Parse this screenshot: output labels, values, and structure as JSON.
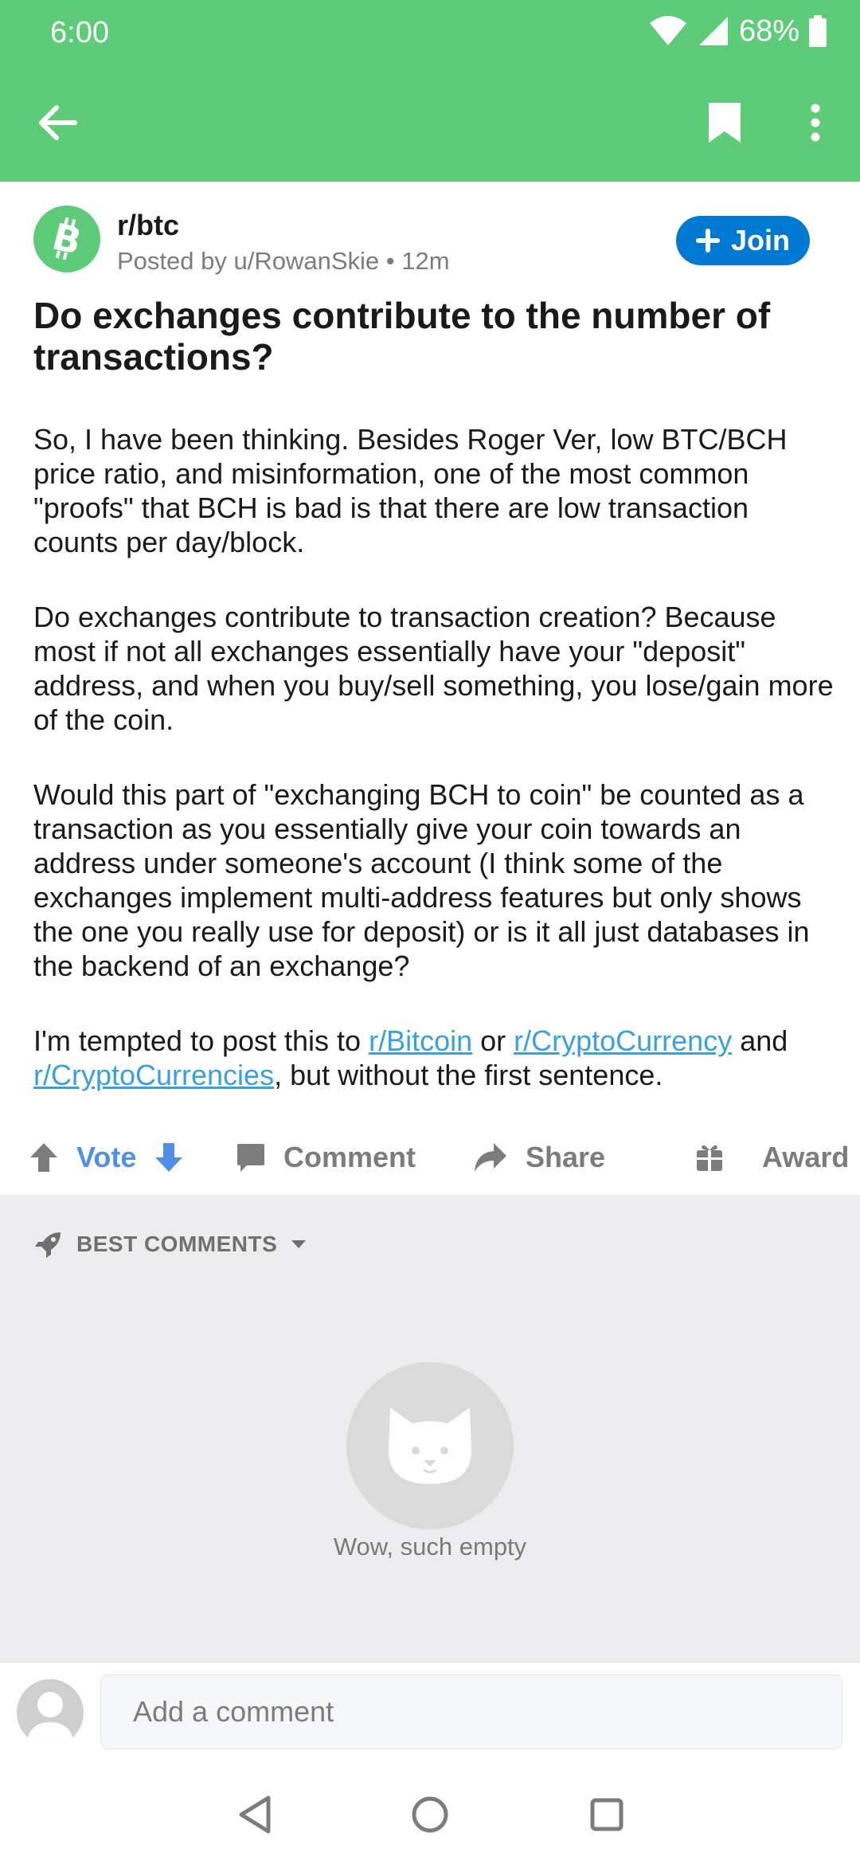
{
  "status_bar": {
    "time": "6:00",
    "battery": "68%"
  },
  "app_bar": {
    "back_icon": "arrow-left-icon",
    "bookmark_icon": "bookmark-icon",
    "more_icon": "more-vert-icon"
  },
  "post": {
    "subreddit": "r/btc",
    "meta": "Posted by u/RowanSkie • 12m",
    "join_label": "Join",
    "title": "Do exchanges contribute to the number of transactions?",
    "paragraphs": [
      "So, I have been thinking. Besides Roger Ver, low BTC/BCH price ratio, and misinformation, one of the most common \"proofs\" that BCH is bad is that there are low transaction counts per day/block.",
      "Do exchanges contribute to transaction creation? Because most if not all exchanges essentially have your \"deposit\" address, and when you buy/sell something, you lose/gain more of the coin.",
      "Would this part of \"exchanging BCH to coin\" be counted as a transaction as you essentially give your coin towards an address under someone's account (I think some of the exchanges implement multi-address features but only shows the one you really use for deposit) or is it all just databases in the backend of an exchange?"
    ],
    "last_paragraph": {
      "prefix": "I'm tempted to post this to ",
      "link1": "r/Bitcoin",
      "mid1": " or ",
      "link2": "r/CryptoCurrency",
      "mid2": " and ",
      "link3": "r/CryptoCurrencies",
      "suffix": ", but without the first sentence."
    }
  },
  "actions": {
    "vote": "Vote",
    "comment": "Comment",
    "share": "Share",
    "award": "Award"
  },
  "comments": {
    "sort_label": "BEST COMMENTS",
    "empty_text": "Wow, such empty"
  },
  "comment_input": {
    "placeholder": "Add a comment"
  },
  "colors": {
    "brand_green": "#5ecb79",
    "join_blue": "#0079d3",
    "vote_blue": "#4f8fea",
    "link_blue": "#3aa0d8"
  }
}
